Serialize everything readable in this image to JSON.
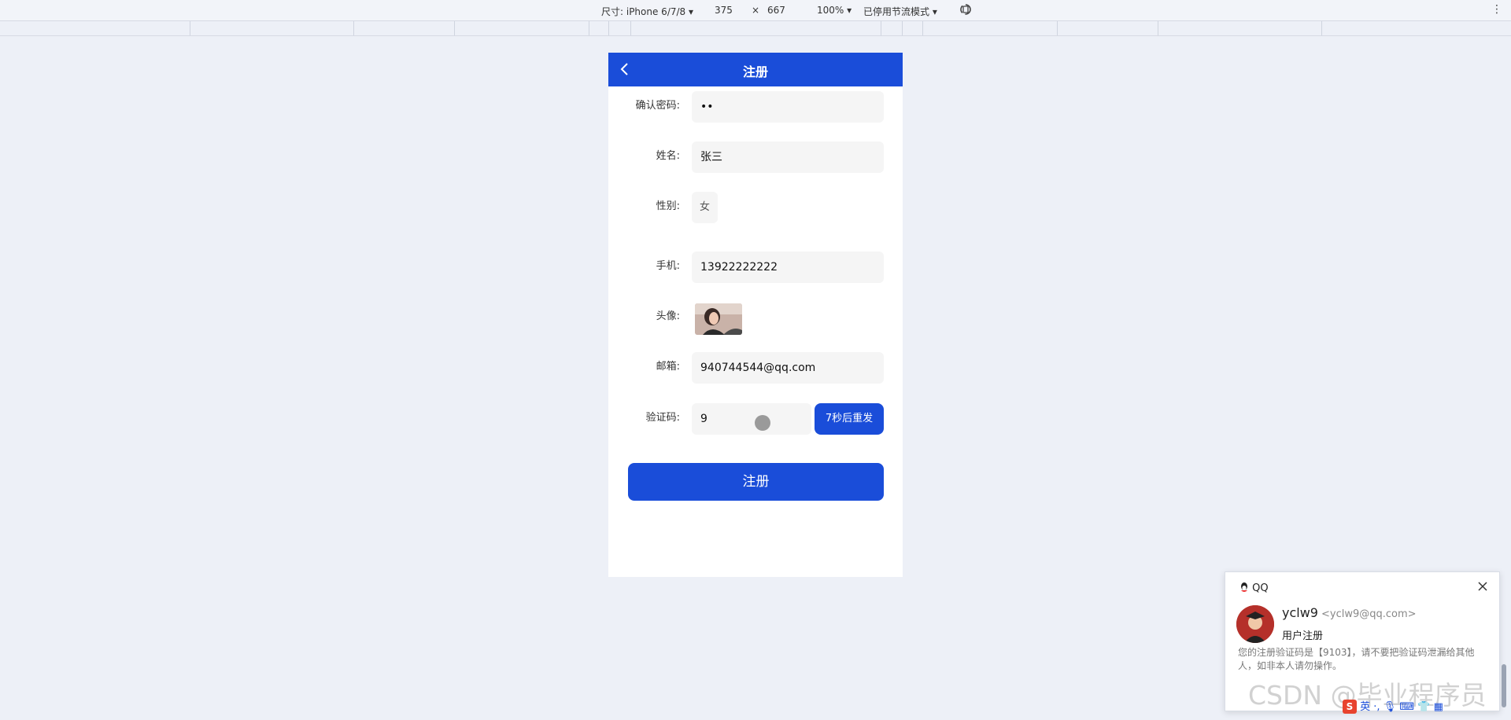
{
  "devtools": {
    "device_label": "尺寸: iPhone 6/7/8 ▾",
    "width": "375",
    "times": "×",
    "height": "667",
    "zoom": "100% ▾",
    "throttle": "已停用节流模式 ▾"
  },
  "app": {
    "title": "注册",
    "fields": {
      "confirm_password": {
        "label": "确认密码:",
        "value": "••"
      },
      "name": {
        "label": "姓名:",
        "value": "张三"
      },
      "gender": {
        "label": "性别:",
        "value": "女"
      },
      "phone": {
        "label": "手机:",
        "value": "13922222222"
      },
      "avatar": {
        "label": "头像:"
      },
      "email": {
        "label": "邮箱:",
        "value": "940744544@qq.com"
      },
      "captcha": {
        "label": "验证码:",
        "value": "9"
      }
    },
    "resend_label": "7秒后重发",
    "submit_label": "注册",
    "accent_color": "#1a4dd9"
  },
  "notification": {
    "brand": "QQ",
    "sender": "yclw9",
    "sender_email": "<yclw9@qq.com>",
    "subject": "用户注册",
    "body": "您的注册验证码是【9103】，请不要把验证码泄漏给其他人，如非本人请勿操作。"
  },
  "watermark": "CSDN @毕业程序员",
  "tray": {
    "ime": "英"
  }
}
